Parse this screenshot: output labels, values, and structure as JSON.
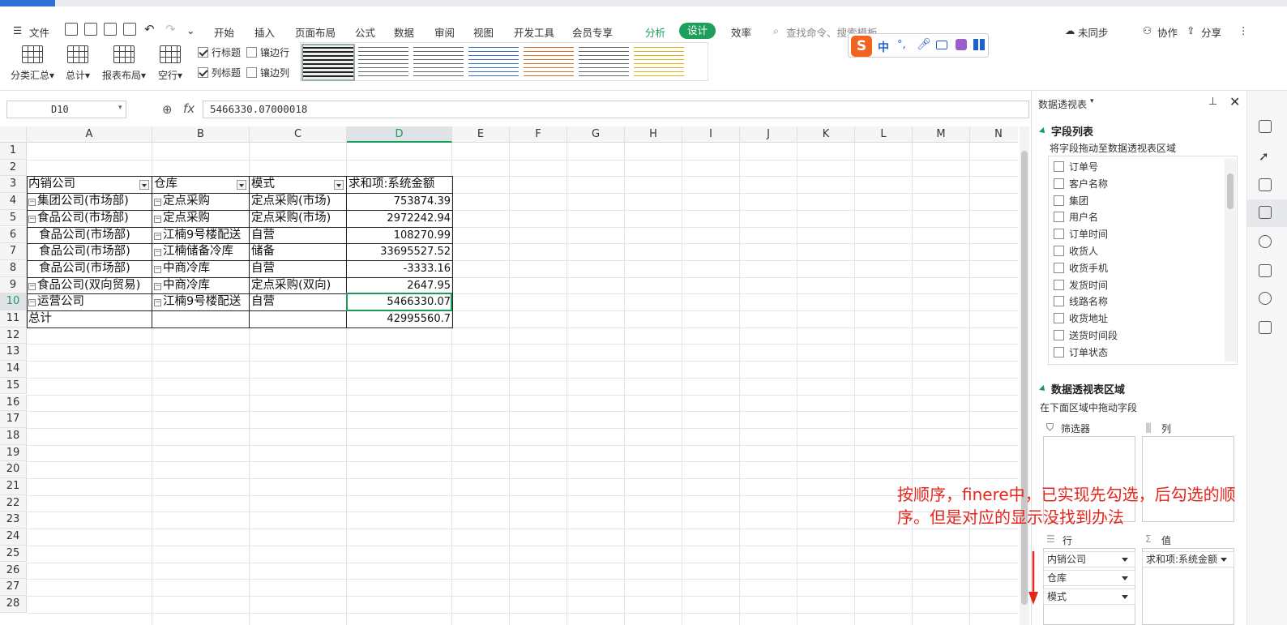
{
  "menubar": {
    "file": "文件",
    "items": [
      "开始",
      "插入",
      "页面布局",
      "公式",
      "数据",
      "审阅",
      "视图",
      "开发工具",
      "会员专享"
    ],
    "analyze": "分析",
    "design": "设计",
    "efficiency": "效率",
    "search_placeholder": "查找命令、搜索模板",
    "unsync": "未同步",
    "collab": "协作",
    "share": "分享"
  },
  "ribbon": {
    "subtotal": "分类汇总",
    "total": "总计",
    "report_layout": "报表布局",
    "blank_row": "空行",
    "row_header": "行标题",
    "banded_rows": "镶边行",
    "col_header": "列标题",
    "banded_cols": "镶边列"
  },
  "formula_bar": {
    "name_box": "D10",
    "fx": "fx",
    "value": "5466330.07000018"
  },
  "columns": [
    "A",
    "B",
    "C",
    "D",
    "E",
    "F",
    "G",
    "H",
    "I",
    "J",
    "K",
    "L",
    "M",
    "N"
  ],
  "rows": [
    "1",
    "2",
    "3",
    "4",
    "5",
    "6",
    "7",
    "8",
    "9",
    "10",
    "11",
    "12",
    "13",
    "14",
    "15",
    "16",
    "17",
    "18",
    "19",
    "20",
    "21",
    "22",
    "23",
    "24",
    "25",
    "26",
    "27",
    "28"
  ],
  "pivot": {
    "headers": [
      "内销公司",
      "仓库",
      "模式",
      "求和项:系统金额"
    ],
    "data": [
      {
        "a": "集团公司(市场部)",
        "b": "定点采购",
        "c": "定点采购(市场)",
        "d": "753874.39",
        "ma": true,
        "mb": true
      },
      {
        "a": "食品公司(市场部)",
        "b": "定点采购",
        "c": "定点采购(市场)",
        "d": "2972242.94",
        "ma": true,
        "mb": true
      },
      {
        "a": "食品公司(市场部)",
        "b": "江楠9号楼配送",
        "c": "自营",
        "d": "108270.99",
        "ma": false,
        "mb": true
      },
      {
        "a": "食品公司(市场部)",
        "b": "江楠储备冷库",
        "c": "储备",
        "d": "33695527.52",
        "ma": false,
        "mb": true
      },
      {
        "a": "食品公司(市场部)",
        "b": "中商冷库",
        "c": "自营",
        "d": "-3333.16",
        "ma": false,
        "mb": true
      },
      {
        "a": "食品公司(双向贸易)",
        "b": "中商冷库",
        "c": "定点采购(双向)",
        "d": "2647.95",
        "ma": true,
        "mb": true
      },
      {
        "a": "运营公司",
        "b": "江楠9号楼配送",
        "c": "自营",
        "d": "5466330.07",
        "ma": true,
        "mb": true
      }
    ],
    "total_label": "总计",
    "total_value": "42995560.7"
  },
  "panel": {
    "title": "数据透视表",
    "field_list": "字段列表",
    "drag_hint": "将字段拖动至数据透视表区域",
    "fields": [
      "订单号",
      "客户名称",
      "集团",
      "用户名",
      "订单时间",
      "收货人",
      "收货手机",
      "发货时间",
      "线路名称",
      "收货地址",
      "送货时间段",
      "订单状态"
    ],
    "area_title": "数据透视表区域",
    "area_hint": "在下面区域中拖动字段",
    "filter": "筛选器",
    "column": "列",
    "row": "行",
    "value": "值",
    "row_fields": [
      "内销公司",
      "仓库",
      "模式"
    ],
    "value_fields": [
      "求和项:系统金额"
    ]
  },
  "ime": {
    "lang": "中"
  },
  "annotation": "按顺序，finere中，已实现先勾选，后勾选的顺序。但是对应的显示没找到办法",
  "colors": {
    "accent": "#1a9c5a",
    "annotation": "#e5261d"
  }
}
